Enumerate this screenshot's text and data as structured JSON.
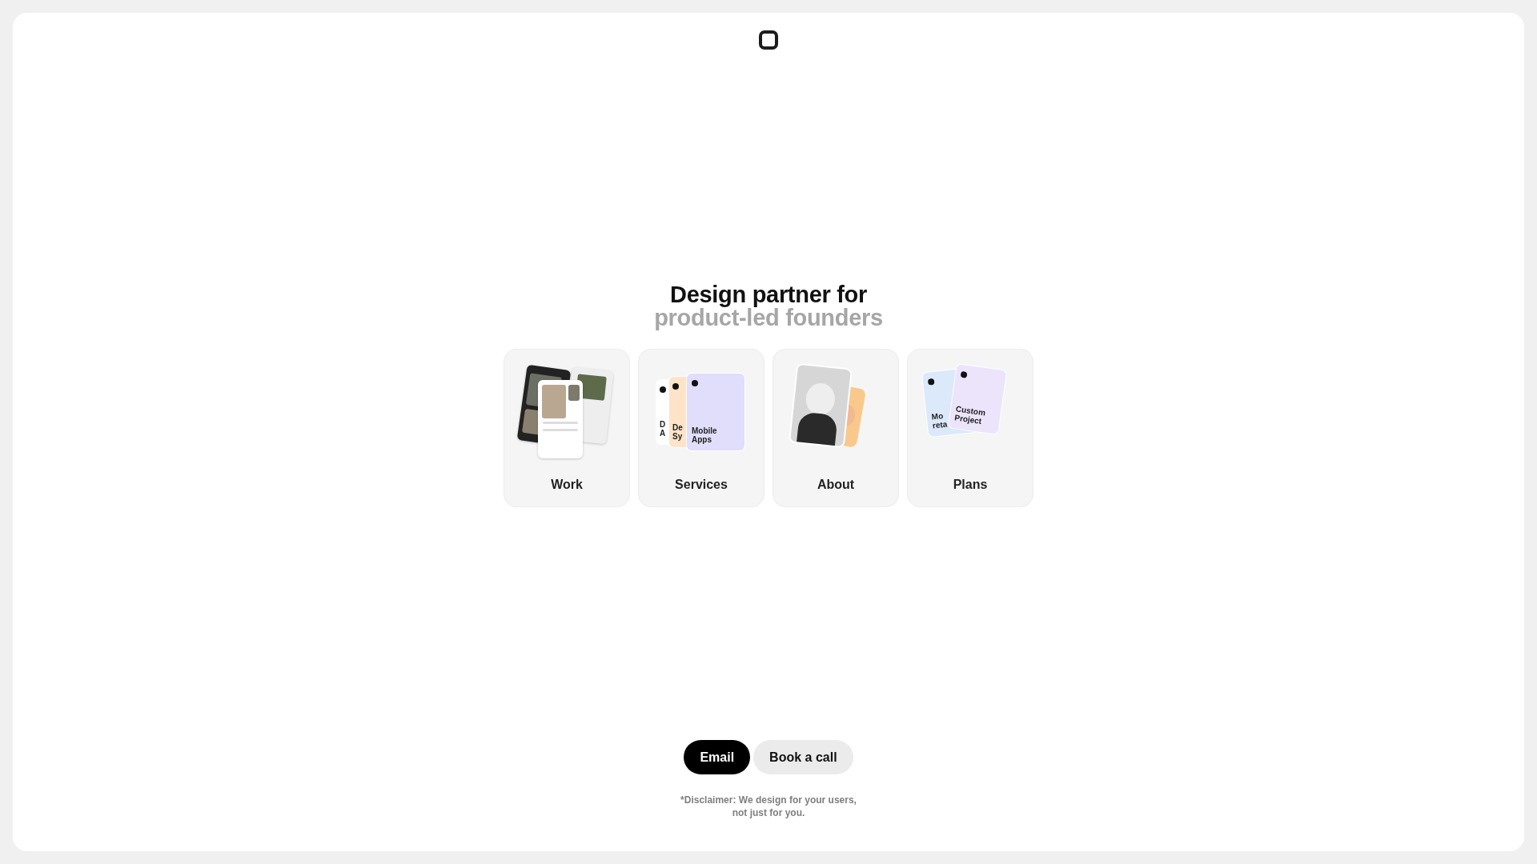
{
  "heading": {
    "line_1": "Design partner for",
    "line_2": "product-led founders"
  },
  "cards": [
    {
      "kind": "work",
      "label": "Work"
    },
    {
      "kind": "services",
      "label": "Services",
      "sheets": [
        {
          "lines": [
            "D",
            "A"
          ],
          "color": "#ffffff"
        },
        {
          "lines": [
            "De",
            "Sy"
          ],
          "color": "#fde3c8"
        },
        {
          "lines": [
            "Mobile",
            "Apps"
          ],
          "color": "#e0defa"
        }
      ]
    },
    {
      "kind": "about",
      "label": "About"
    },
    {
      "kind": "plans",
      "label": "Plans",
      "sheets": [
        {
          "lines": [
            "Mo",
            "reta"
          ],
          "color": "#dbe9fb"
        },
        {
          "lines": [
            "Custom",
            "Project"
          ],
          "color": "#ece4fb"
        }
      ]
    }
  ],
  "buttons": [
    {
      "label": "Email",
      "kind": "primary"
    },
    {
      "label": "Book a call",
      "kind": "secondary"
    }
  ],
  "disclaimer": [
    "*Disclaimer: We design for your users,",
    "not just for you."
  ]
}
